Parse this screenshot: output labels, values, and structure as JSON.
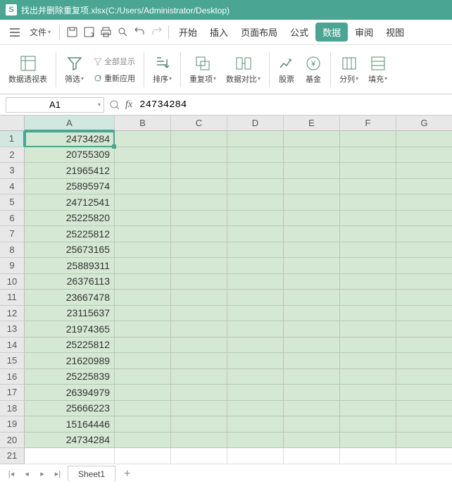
{
  "titlebar": {
    "icon": "S",
    "filename": "找出并删除重复项.xlsx",
    "path": "(C:/Users/Administrator/Desktop)"
  },
  "menubar": {
    "file": "文件"
  },
  "tabs": {
    "start": "开始",
    "insert": "插入",
    "layout": "页面布局",
    "formula": "公式",
    "data": "数据",
    "review": "审阅",
    "view": "视图"
  },
  "ribbon": {
    "pivot": "数据透视表",
    "filter": "筛选",
    "show_all": "全部显示",
    "reapply": "重新应用",
    "sort": "排序",
    "duplicates": "重复项",
    "compare": "数据对比",
    "stock": "股票",
    "fund": "基金",
    "split": "分列",
    "fill": "填充"
  },
  "formula_bar": {
    "name_box": "A1",
    "fx": "fx",
    "value": "24734284"
  },
  "columns": [
    "A",
    "B",
    "C",
    "D",
    "E",
    "F",
    "G"
  ],
  "data_rows": [
    "24734284",
    "20755309",
    "21965412",
    "25895974",
    "24712541",
    "25225820",
    "25225812",
    "25673165",
    "25889311",
    "26376113",
    "23667478",
    "23115637",
    "21974365",
    "25225812",
    "21620989",
    "25225839",
    "26394979",
    "25666223",
    "15164446",
    "24734284"
  ],
  "empty_row": "21",
  "sheet_tabs": {
    "sheet1": "Sheet1"
  }
}
